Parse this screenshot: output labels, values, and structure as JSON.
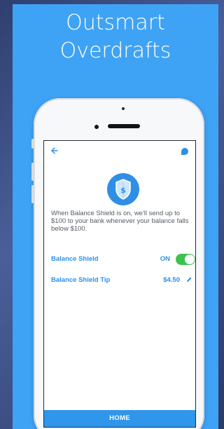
{
  "headline": {
    "line1": "Outsmart",
    "line2": "Overdrafts"
  },
  "screen": {
    "description": "When Balance Shield is on, we'll send up to $100 to your bank whenever your balance falls below $100.",
    "balance_shield": {
      "label": "Balance Shield",
      "state": "ON",
      "enabled": true
    },
    "balance_shield_tip": {
      "label": "Balance Shield Tip",
      "amount": "$4.50"
    },
    "home_tab": {
      "label": "HOME"
    }
  },
  "icons": {
    "back": "back-arrow-icon",
    "chat": "chat-bubble-icon",
    "shield": "shield-dollar-icon",
    "edit": "pencil-icon"
  },
  "colors": {
    "panel_background": "#3fa3f5",
    "accent_blue": "#2d8fe8",
    "toggle_on": "#3ec24f"
  }
}
